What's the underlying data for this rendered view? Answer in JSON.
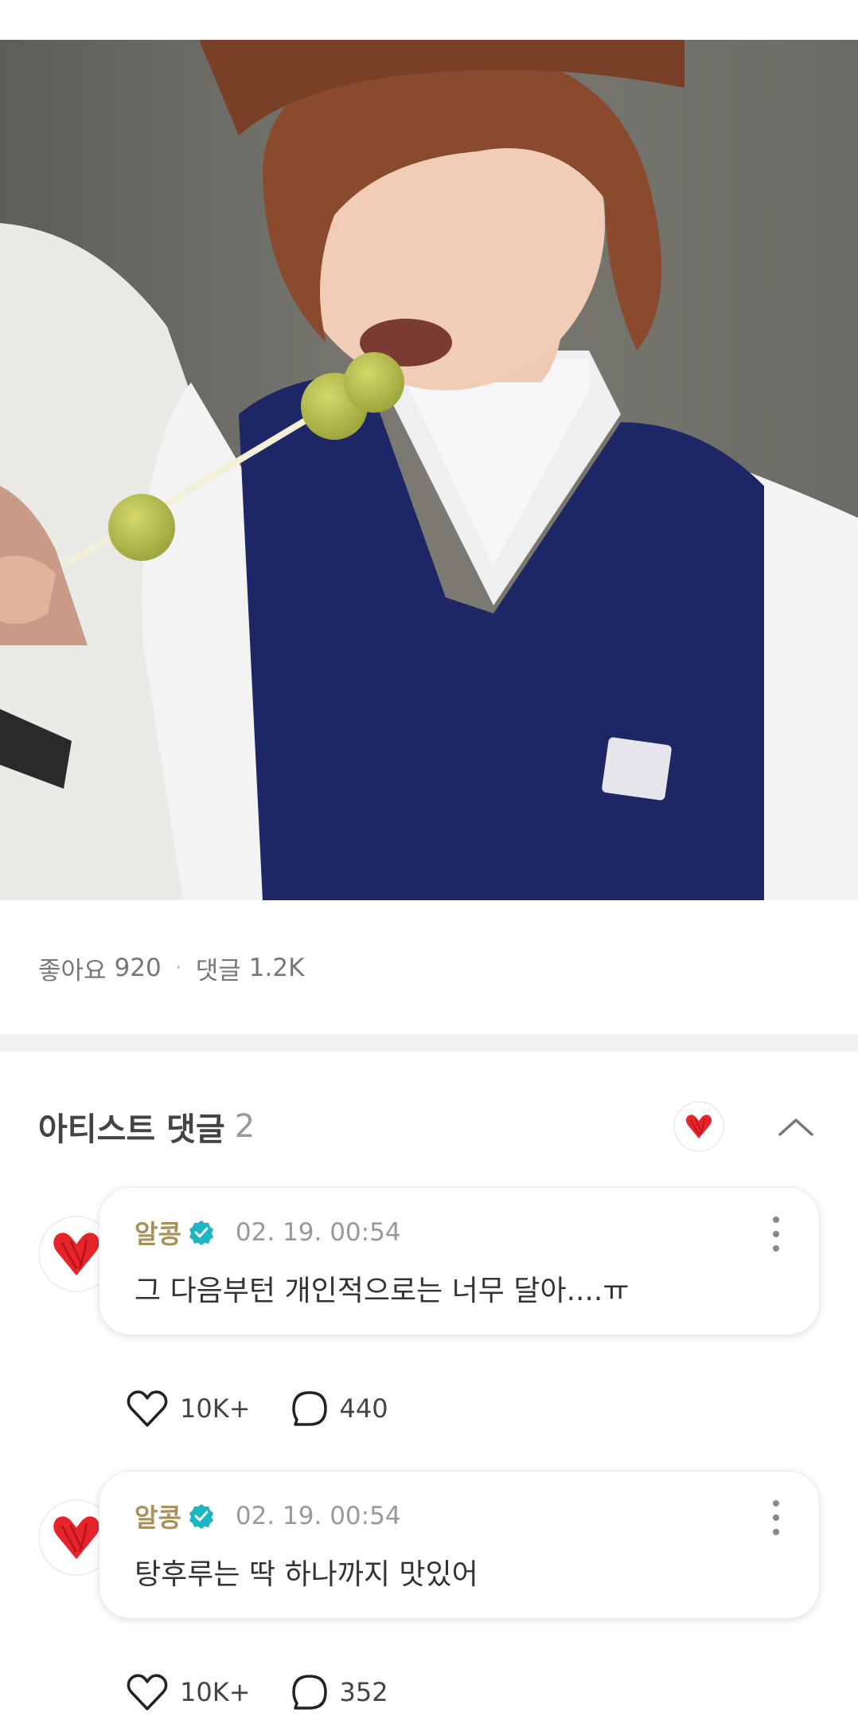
{
  "stats": {
    "likes_label": "좋아요",
    "likes_count": "920",
    "separator": "·",
    "comments_label": "댓글",
    "comments_count": "1.2K"
  },
  "artist_comments": {
    "title": "아티스트 댓글",
    "count": "2",
    "heart_icon": "red-heart-icon",
    "collapse_icon": "chevron-up-icon",
    "items": [
      {
        "avatar_icon": "red-heart-icon",
        "author": "알콩",
        "verified_icon": "verified-badge-icon",
        "time": "02. 19. 00:54",
        "text": "그 다음부턴 개인적으로는 너무 달아....ㅠ",
        "likes": "10K+",
        "replies": "440"
      },
      {
        "avatar_icon": "red-heart-icon",
        "author": "알콩",
        "verified_icon": "verified-badge-icon",
        "time": "02. 19. 00:54",
        "text": "탕후루는 딱 하나까지 맛있어",
        "likes": "10K+",
        "replies": "352"
      }
    ]
  },
  "colors": {
    "author": "#a8905c",
    "verified": "#1bb5c4",
    "heart": "#e8242b",
    "muted": "#999999"
  }
}
